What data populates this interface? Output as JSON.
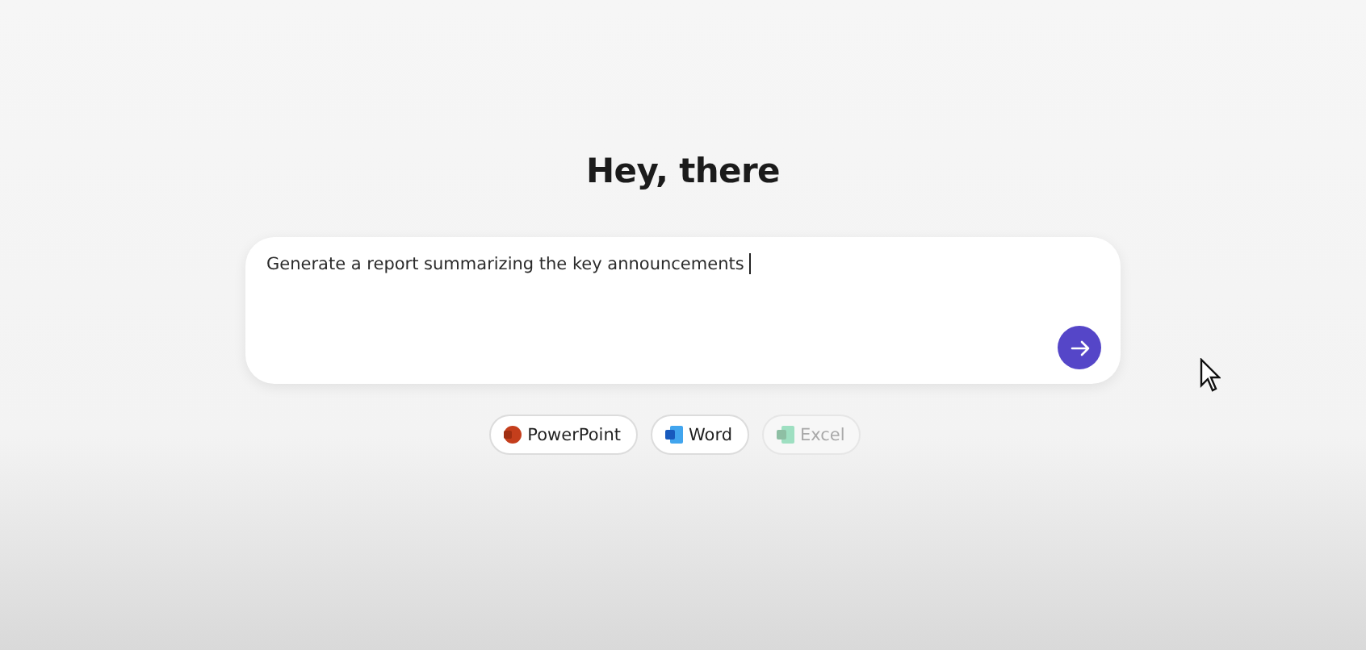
{
  "heading": "Hey, there",
  "prompt": {
    "value": "Generate a report summarizing the key announcements"
  },
  "apps": [
    {
      "label": "PowerPoint",
      "kind": "powerpoint",
      "disabled": false
    },
    {
      "label": "Word",
      "kind": "word",
      "disabled": false
    },
    {
      "label": "Excel",
      "kind": "excel",
      "disabled": true
    }
  ]
}
